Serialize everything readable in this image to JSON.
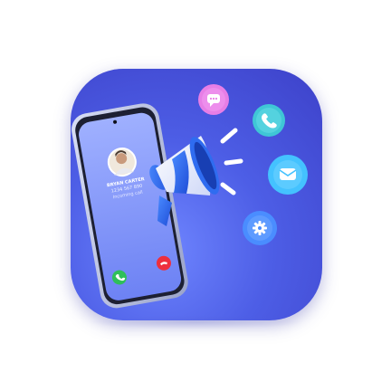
{
  "app_icon": {
    "caller": {
      "name": "BRYAN CARTER",
      "number": "1234 567 890",
      "status": "Incoming call"
    },
    "bubbles": [
      {
        "icon": "chat-icon",
        "color": "#e77ee6"
      },
      {
        "icon": "phone-icon",
        "color": "#3fc6d6"
      },
      {
        "icon": "message-icon",
        "color": "#44c2ff"
      },
      {
        "icon": "gear-icon",
        "color": "#4a8dff"
      }
    ],
    "colors": {
      "tile_top": "#3d41c9",
      "tile_bottom": "#6f86ff",
      "accept_call": "#2fbf5a",
      "decline_call": "#ee2f3d",
      "megaphone_blue": "#2f6cf0",
      "megaphone_white": "#f2f5ff"
    }
  }
}
